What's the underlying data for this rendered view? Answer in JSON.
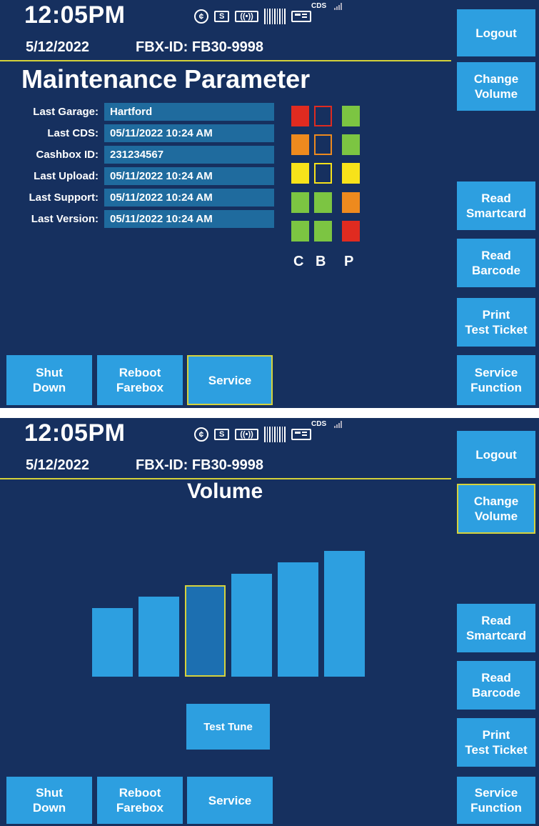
{
  "colors": {
    "background": "#16305f",
    "button": "#2d9fe0",
    "selected_border": "#d6d23c",
    "field": "#1f6b9e",
    "red": "#e02b20",
    "orange": "#ee8a1e",
    "yellow": "#f7e21a",
    "green": "#7cc542"
  },
  "status_bar": {
    "time": "12:05PM",
    "date": "5/12/2022",
    "fbx_id": "FBX-ID: FB30-9998",
    "icons": {
      "coin": "¢",
      "bill": "S",
      "contactless": "((•))",
      "barcode": "barcode-icon",
      "card": "card-icon",
      "cds": "CDS",
      "signal": "signal-icon"
    }
  },
  "side_buttons": {
    "logout": "Logout",
    "change_volume": "Change\nVolume",
    "read_smartcard": "Read\nSmartcard",
    "read_barcode": "Read\nBarcode",
    "print_test_ticket": "Print\nTest Ticket",
    "service_function": "Service\nFunction"
  },
  "bottom_buttons": {
    "shut_down": "Shut\nDown",
    "reboot_farebox": "Reboot\nFarebox",
    "service": "Service"
  },
  "maintenance": {
    "title": "Maintenance Parameter",
    "params": [
      {
        "label": "Last Garage:",
        "value": "Hartford"
      },
      {
        "label": "Last CDS:",
        "value": "05/11/2022 10:24 AM"
      },
      {
        "label": "Cashbox ID:",
        "value": "231234567"
      },
      {
        "label": "Last Upload:",
        "value": "05/11/2022 10:24 AM"
      },
      {
        "label": "Last Support:",
        "value": "05/11/2022 10:24 AM"
      },
      {
        "label": "Last Version:",
        "value": "05/11/2022 10:24 AM"
      }
    ],
    "indicators": {
      "C": [
        "red",
        "orange",
        "yellow",
        "green",
        "green"
      ],
      "B": [
        "red-outline",
        "orange-outline",
        "yellow-outline",
        "green",
        "green"
      ],
      "P": [
        "green",
        "green",
        "yellow",
        "orange",
        "red"
      ]
    },
    "column_labels": [
      "C",
      "B",
      "P"
    ]
  },
  "volume": {
    "title": "Volume",
    "level_count": 6,
    "selected_level": 3,
    "test_tune": "Test Tune"
  }
}
